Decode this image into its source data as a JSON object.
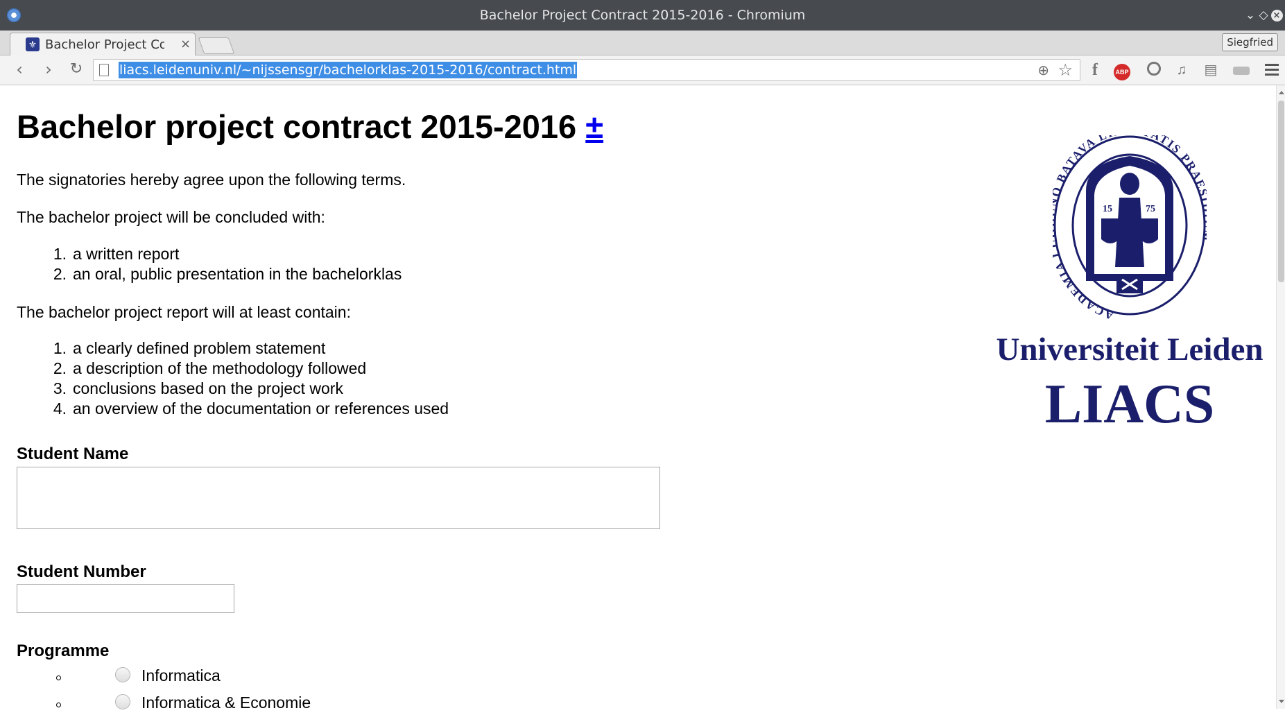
{
  "window": {
    "title": "Bachelor Project Contract 2015-2016 - Chromium",
    "controls": {
      "minimize": "⌄",
      "maximize": "◇",
      "close": "×"
    }
  },
  "tabs": [
    {
      "label": "Bachelor Project Cor",
      "close": "×",
      "active": true
    }
  ],
  "profile": {
    "name": "Siegfried"
  },
  "toolbar": {
    "back": "‹",
    "forward": "›",
    "reload": "↻",
    "url": "liacs.leidenuniv.nl/~nijssensgr/bachelorklas-2015-2016/contract.html",
    "extensions": [
      "facebook-icon",
      "adblock-plus-icon",
      "compass-icon",
      "music-icon",
      "stack-icon",
      "pill-icon"
    ],
    "abp_label": "ABP",
    "fb_glyph": "f"
  },
  "page": {
    "title": "Bachelor project contract 2015-2016",
    "title_link": "±",
    "intro": "The signatories hereby agree upon the following terms.",
    "concluded_intro": "The bachelor project will be concluded with:",
    "concluded_items": [
      "a written report",
      "an oral, public presentation in the bachelorklas"
    ],
    "report_intro": "The bachelor project report will at least contain:",
    "report_items": [
      "a clearly defined problem statement",
      "a description of the methodology followed",
      "conclusions based on the project work",
      "an overview of the documentation or references used"
    ],
    "student_name_label": "Student Name",
    "student_name_value": "",
    "student_number_label": "Student Number",
    "student_number_value": "",
    "programme_label": "Programme",
    "programme_options": [
      "Informatica",
      "Informatica & Economie"
    ]
  },
  "logo": {
    "seal_text": "ACADEMIA LUGDUNO BATAVA LIBERTATIS PRAESIDIUM",
    "seal_numbers": [
      "15",
      "75"
    ],
    "line1": "Universiteit Leiden",
    "line2": "LIACS"
  },
  "colors": {
    "titlebar": "#474b50",
    "url_highlight": "#3f8ee6",
    "link": "#0000ee",
    "logo_blue": "#1b1f6b"
  }
}
